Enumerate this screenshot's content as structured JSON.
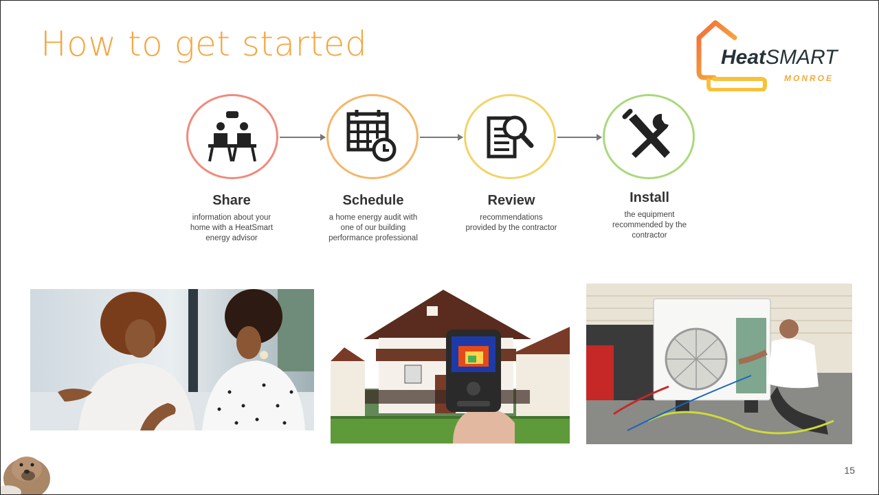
{
  "slide": {
    "title": "How to get started",
    "page_number": "15"
  },
  "logo": {
    "word_bold": "Heat",
    "word_light": "SMART",
    "sub": "MONROE"
  },
  "steps": [
    {
      "title": "Share",
      "desc_lines": [
        "information about your",
        "home with a HeatSmart",
        "energy advisor"
      ],
      "icon": "meeting-icon",
      "color": "#f08a7a"
    },
    {
      "title": "Schedule",
      "desc_lines": [
        "a home energy audit with",
        "one of our building",
        "performance professional"
      ],
      "icon": "calendar-clock-icon",
      "color": "#f5b66a"
    },
    {
      "title": "Review",
      "desc_lines": [
        "recommendations",
        "provided by the contractor"
      ],
      "icon": "document-magnifier-icon",
      "color": "#f2d466"
    },
    {
      "title": "Install",
      "desc_lines": [
        "the equipment",
        "recommended by the",
        "contractor"
      ],
      "icon": "tools-icon",
      "color": "#a9d97b"
    }
  ],
  "photos": [
    {
      "name": "photo-two-women-talking"
    },
    {
      "name": "photo-house-thermal-camera"
    },
    {
      "name": "photo-heat-pump-installation"
    },
    {
      "name": "photo-groundhog"
    }
  ]
}
